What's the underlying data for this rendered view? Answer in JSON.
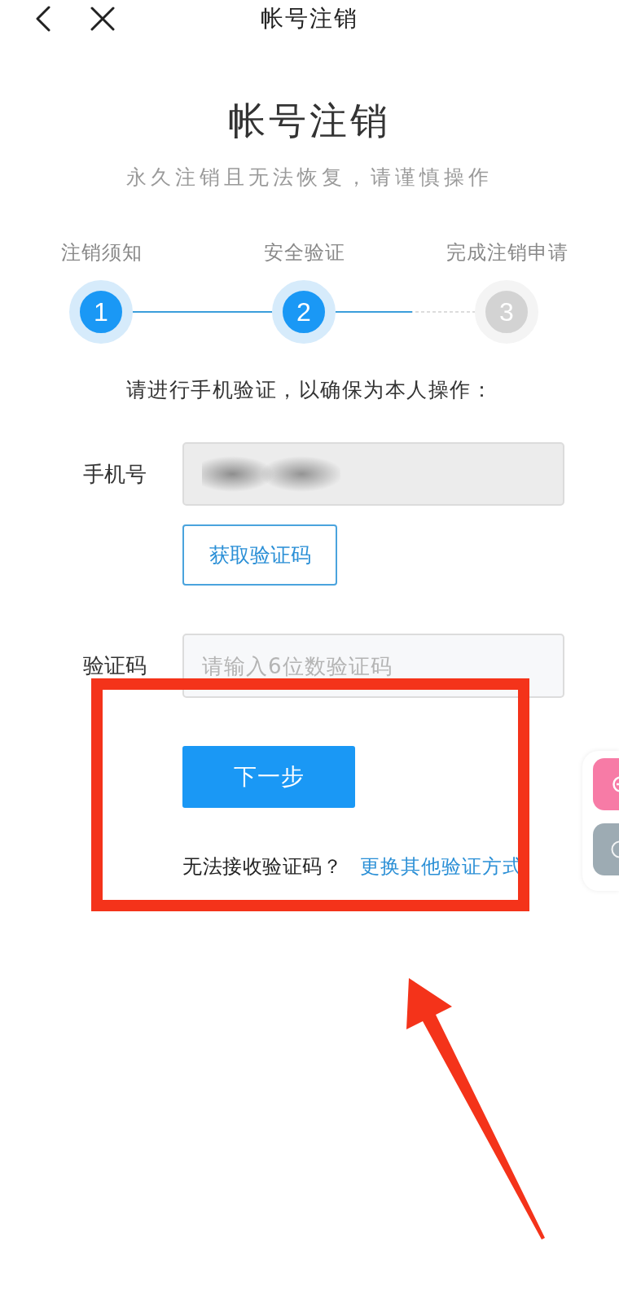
{
  "top_bar": {
    "title": "帐号注销"
  },
  "header": {
    "title": "帐号注销",
    "subtitle": "永久注销且无法恢复，请谨慎操作"
  },
  "steps": [
    {
      "label": "注销须知",
      "number": "1",
      "active": true
    },
    {
      "label": "安全验证",
      "number": "2",
      "active": true
    },
    {
      "label": "完成注销申请",
      "number": "3",
      "active": false
    }
  ],
  "connectors": [
    {
      "kind": "solid"
    },
    {
      "kind": "progress",
      "level": 0.55
    }
  ],
  "instruction": "请进行手机验证，以确保为本人操作：",
  "phone": {
    "label": "手机号",
    "disabled": true,
    "value_blurred": true
  },
  "get_code_button": "获取验证码",
  "code": {
    "label": "验证码",
    "placeholder": "请输入6位数验证码"
  },
  "next_button": "下一步",
  "help": {
    "text": "无法接收验证码？",
    "link": "更换其他验证方式"
  },
  "side_buttons": [
    {
      "kind": "add"
    },
    {
      "kind": "ring"
    }
  ],
  "annotations": {
    "highlight_frame": true,
    "arrow": true
  }
}
